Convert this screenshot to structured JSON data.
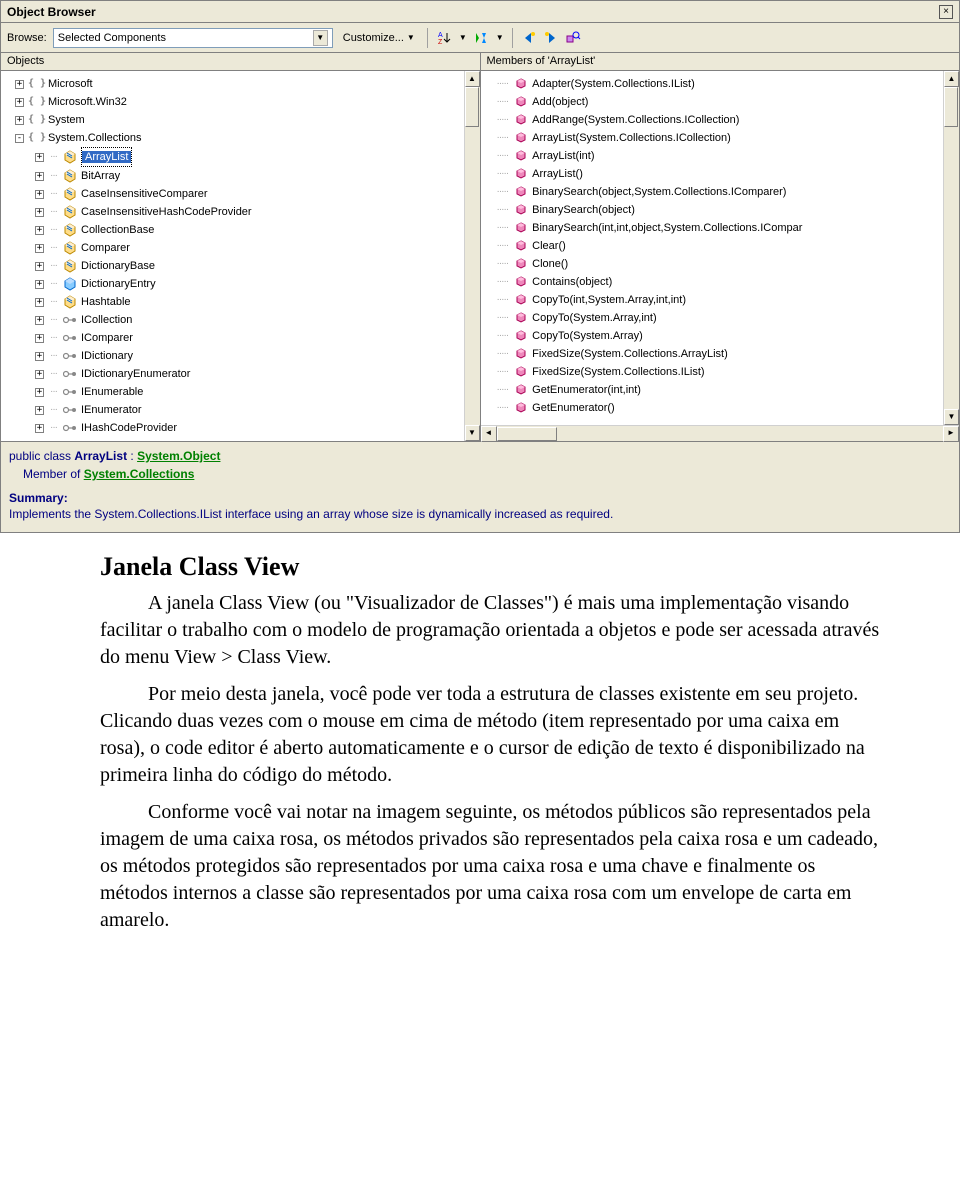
{
  "window": {
    "title": "Object Browser"
  },
  "toolbar": {
    "browse_label": "Browse:",
    "browse_value": "Selected Components",
    "customize_label": "Customize..."
  },
  "panes": {
    "left_header": "Objects",
    "right_header": "Members of 'ArrayList'"
  },
  "objects": [
    {
      "indent": 0,
      "exp": "+",
      "icon": "ns",
      "label": "Microsoft"
    },
    {
      "indent": 0,
      "exp": "+",
      "icon": "ns",
      "label": "Microsoft.Win32"
    },
    {
      "indent": 0,
      "exp": "+",
      "icon": "ns",
      "label": "System"
    },
    {
      "indent": 0,
      "exp": "-",
      "icon": "ns",
      "label": "System.Collections"
    },
    {
      "indent": 1,
      "exp": "+",
      "icon": "class",
      "label": "ArrayList",
      "selected": true
    },
    {
      "indent": 1,
      "exp": "+",
      "icon": "class",
      "label": "BitArray"
    },
    {
      "indent": 1,
      "exp": "+",
      "icon": "class",
      "label": "CaseInsensitiveComparer"
    },
    {
      "indent": 1,
      "exp": "+",
      "icon": "class",
      "label": "CaseInsensitiveHashCodeProvider"
    },
    {
      "indent": 1,
      "exp": "+",
      "icon": "class",
      "label": "CollectionBase"
    },
    {
      "indent": 1,
      "exp": "+",
      "icon": "class",
      "label": "Comparer"
    },
    {
      "indent": 1,
      "exp": "+",
      "icon": "class",
      "label": "DictionaryBase"
    },
    {
      "indent": 1,
      "exp": "+",
      "icon": "struct",
      "label": "DictionaryEntry"
    },
    {
      "indent": 1,
      "exp": "+",
      "icon": "class",
      "label": "Hashtable"
    },
    {
      "indent": 1,
      "exp": "+",
      "icon": "iface",
      "label": "ICollection"
    },
    {
      "indent": 1,
      "exp": "+",
      "icon": "iface",
      "label": "IComparer"
    },
    {
      "indent": 1,
      "exp": "+",
      "icon": "iface",
      "label": "IDictionary"
    },
    {
      "indent": 1,
      "exp": "+",
      "icon": "iface",
      "label": "IDictionaryEnumerator"
    },
    {
      "indent": 1,
      "exp": "+",
      "icon": "iface",
      "label": "IEnumerable"
    },
    {
      "indent": 1,
      "exp": "+",
      "icon": "iface",
      "label": "IEnumerator"
    },
    {
      "indent": 1,
      "exp": "+",
      "icon": "iface",
      "label": "IHashCodeProvider"
    }
  ],
  "members": [
    {
      "label": "Adapter(System.Collections.IList)"
    },
    {
      "label": "Add(object)"
    },
    {
      "label": "AddRange(System.Collections.ICollection)"
    },
    {
      "label": "ArrayList(System.Collections.ICollection)"
    },
    {
      "label": "ArrayList(int)"
    },
    {
      "label": "ArrayList()"
    },
    {
      "label": "BinarySearch(object,System.Collections.IComparer)"
    },
    {
      "label": "BinarySearch(object)"
    },
    {
      "label": "BinarySearch(int,int,object,System.Collections.IComparer)",
      "clip": true
    },
    {
      "label": "Clear()"
    },
    {
      "label": "Clone()"
    },
    {
      "label": "Contains(object)"
    },
    {
      "label": "CopyTo(int,System.Array,int,int)"
    },
    {
      "label": "CopyTo(System.Array,int)"
    },
    {
      "label": "CopyTo(System.Array)"
    },
    {
      "label": "FixedSize(System.Collections.ArrayList)"
    },
    {
      "label": "FixedSize(System.Collections.IList)"
    },
    {
      "label": "GetEnumerator(int,int)"
    },
    {
      "label": "GetEnumerator()"
    }
  ],
  "detail": {
    "decl_prefix": "public class ",
    "decl_name": "ArrayList",
    "decl_sep": " : ",
    "decl_base": "System.Object",
    "member_prefix": "Member of ",
    "member_link": "System.Collections",
    "summary_label": "Summary:",
    "summary_text": "Implements the System.Collections.IList interface using an array whose size is dynamically increased as required."
  },
  "article": {
    "title": "Janela Class View",
    "p1": "A janela Class View (ou \"Visualizador de Classes\") é mais uma implementação visando facilitar o trabalho com o modelo de programação orientada a objetos e pode ser acessada através do menu View > Class View.",
    "p2": "Por meio desta janela, você pode ver toda a estrutura de classes existente em seu projeto. Clicando duas vezes com o mouse em cima de método (item representado por uma caixa em rosa), o code editor é aberto automaticamente e o cursor de edição de texto é disponibilizado na primeira linha do código do método.",
    "p3": "Conforme você vai notar na imagem seguinte, os métodos públicos são representados pela imagem de uma caixa rosa, os métodos privados são representados pela caixa rosa e um cadeado, os métodos protegidos são representados por uma caixa rosa e uma chave e finalmente os métodos internos a classe são representados por uma caixa rosa com um envelope de carta em amarelo."
  }
}
